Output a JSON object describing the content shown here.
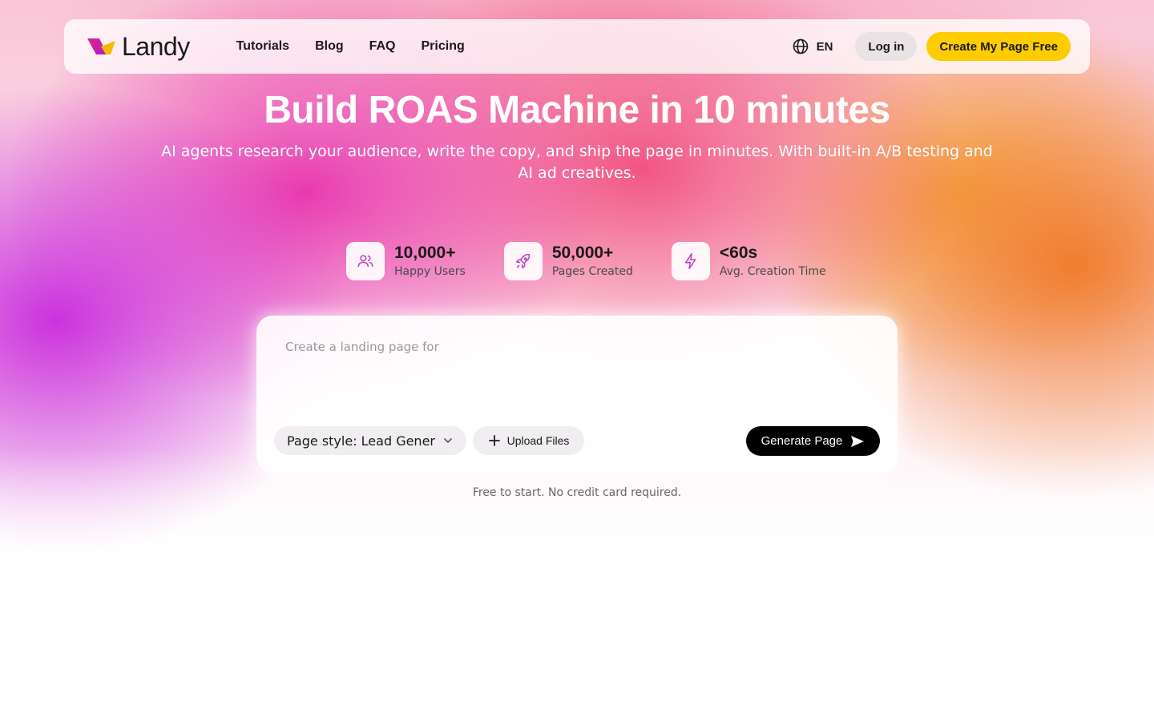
{
  "brand": {
    "name": "Landy"
  },
  "nav": {
    "links": [
      "Tutorials",
      "Blog",
      "FAQ",
      "Pricing"
    ],
    "language": "EN",
    "login_label": "Log in",
    "cta_label": "Create My Page Free"
  },
  "hero": {
    "title": "Build ROAS Machine in 10 minutes",
    "subtitle": "AI agents research your audience, write the copy, and ship the page in minutes. With built-in A/B testing and AI ad creatives."
  },
  "stats": [
    {
      "value": "10,000+",
      "label": "Happy Users",
      "icon": "users-icon"
    },
    {
      "value": "50,000+",
      "label": "Pages Created",
      "icon": "rocket-icon"
    },
    {
      "value": "<60s",
      "label": "Avg. Creation Time",
      "icon": "lightning-icon"
    }
  ],
  "prompt": {
    "placeholder": "Create a landing page for",
    "value": "",
    "style_label": "Page style: Lead Genera...",
    "upload_label": "Upload Files",
    "generate_label": "Generate Page"
  },
  "footnote": "Free to start. No credit card required.",
  "colors": {
    "cta": "#ffcc00",
    "generate_button": "#000000",
    "stat_icon": "#c040c8"
  }
}
